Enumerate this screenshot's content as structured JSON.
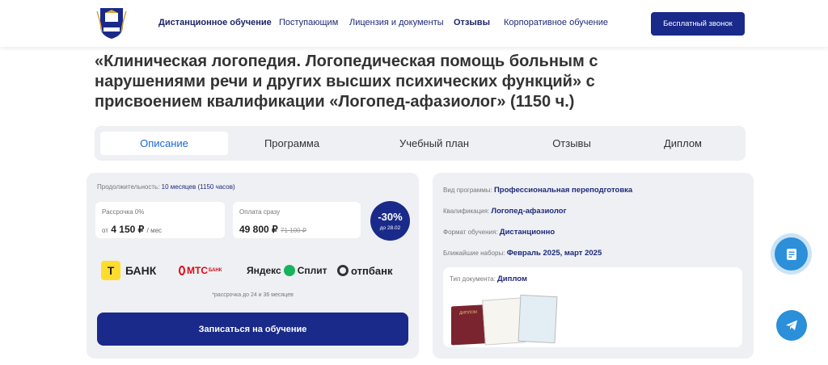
{
  "header": {
    "nav": [
      {
        "label": "Дистанционное обучение"
      },
      {
        "label": "Поступающим"
      },
      {
        "label": "Лицензия и документы"
      },
      {
        "label": "Отзывы"
      },
      {
        "label": "Корпоративное обучение"
      }
    ],
    "cta_label": "Бесплатный звонок",
    "logo_icon": "university-crest-icon"
  },
  "course": {
    "title_lines": [
      "«Клиническая логопедия. Логопедическая помощь больным с",
      "нарушениями речи и других высших психических функций» с",
      "присвоением квалификации «Логопед-афазиолог» (1150 ч.)"
    ]
  },
  "tabs": [
    {
      "label": "Описание",
      "active": true
    },
    {
      "label": "Программа"
    },
    {
      "label": "Учебный план"
    },
    {
      "label": "Отзывы"
    },
    {
      "label": "Диплом"
    }
  ],
  "pricing": {
    "duration_label": "Продолжительность:",
    "duration_value": "10 месяцев (1150 часов)",
    "installment_label": "Рассрочка 0%",
    "installment_prefix": "от",
    "installment_price": "4 150 ₽",
    "installment_unit": "/ мес",
    "full_label": "Оплата сразу",
    "full_price": "49 800 ₽",
    "old_price": "71 100 ₽",
    "discount": "-30%",
    "discount_until": "до 28.02",
    "banks": [
      "БАНК",
      "МТС",
      "БАНК",
      "Яндекс",
      "Сплит",
      "отп",
      "банк"
    ],
    "note": "*рассрочка до 24 и 36 месяцев",
    "enroll_label": "Записаться на обучение"
  },
  "details": {
    "rows": [
      {
        "label": "Вид программы:",
        "value": "Профессиональная переподготовка"
      },
      {
        "label": "Квалификация:",
        "value": "Логопед-афазиолог"
      },
      {
        "label": "Формат обучения:",
        "value": "Дистанционно"
      },
      {
        "label": "Ближайшие наборы:",
        "value": "Февраль 2025, март 2025"
      }
    ],
    "doc_label": "Тип документа:",
    "doc_value": "Диплом",
    "diploma_cover_text": "ДИПЛОМ"
  },
  "colors": {
    "brand": "#1a2a8a",
    "accent_blue": "#1a6bd4",
    "float_blue": "#2b8fd9"
  }
}
